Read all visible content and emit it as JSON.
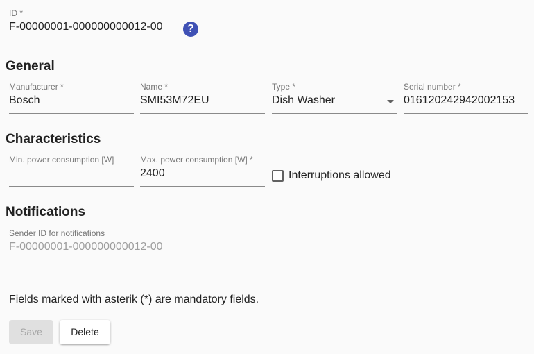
{
  "id_field": {
    "label": "ID *",
    "value": "F-00000001-000000000012-00",
    "help_icon": "?"
  },
  "general": {
    "title": "General",
    "manufacturer": {
      "label": "Manufacturer *",
      "value": "Bosch"
    },
    "name": {
      "label": "Name *",
      "value": "SMI53M72EU"
    },
    "type": {
      "label": "Type *",
      "value": "Dish Washer"
    },
    "serial": {
      "label": "Serial number *",
      "value": "016120242942002153"
    }
  },
  "characteristics": {
    "title": "Characteristics",
    "min_power": {
      "label": "Min. power consumption [W]",
      "value": ""
    },
    "max_power": {
      "label": "Max. power consumption [W] *",
      "value": "2400"
    },
    "interruptions": {
      "label": "Interruptions allowed",
      "checked": false
    }
  },
  "notifications": {
    "title": "Notifications",
    "sender_id": {
      "label": "Sender ID for notifications",
      "value": "F-00000001-000000000012-00"
    }
  },
  "footer": {
    "note": "Fields marked with asterik (*) are mandatory fields.",
    "save_label": "Save",
    "delete_label": "Delete"
  },
  "colors": {
    "accent": "#3f51b5"
  }
}
